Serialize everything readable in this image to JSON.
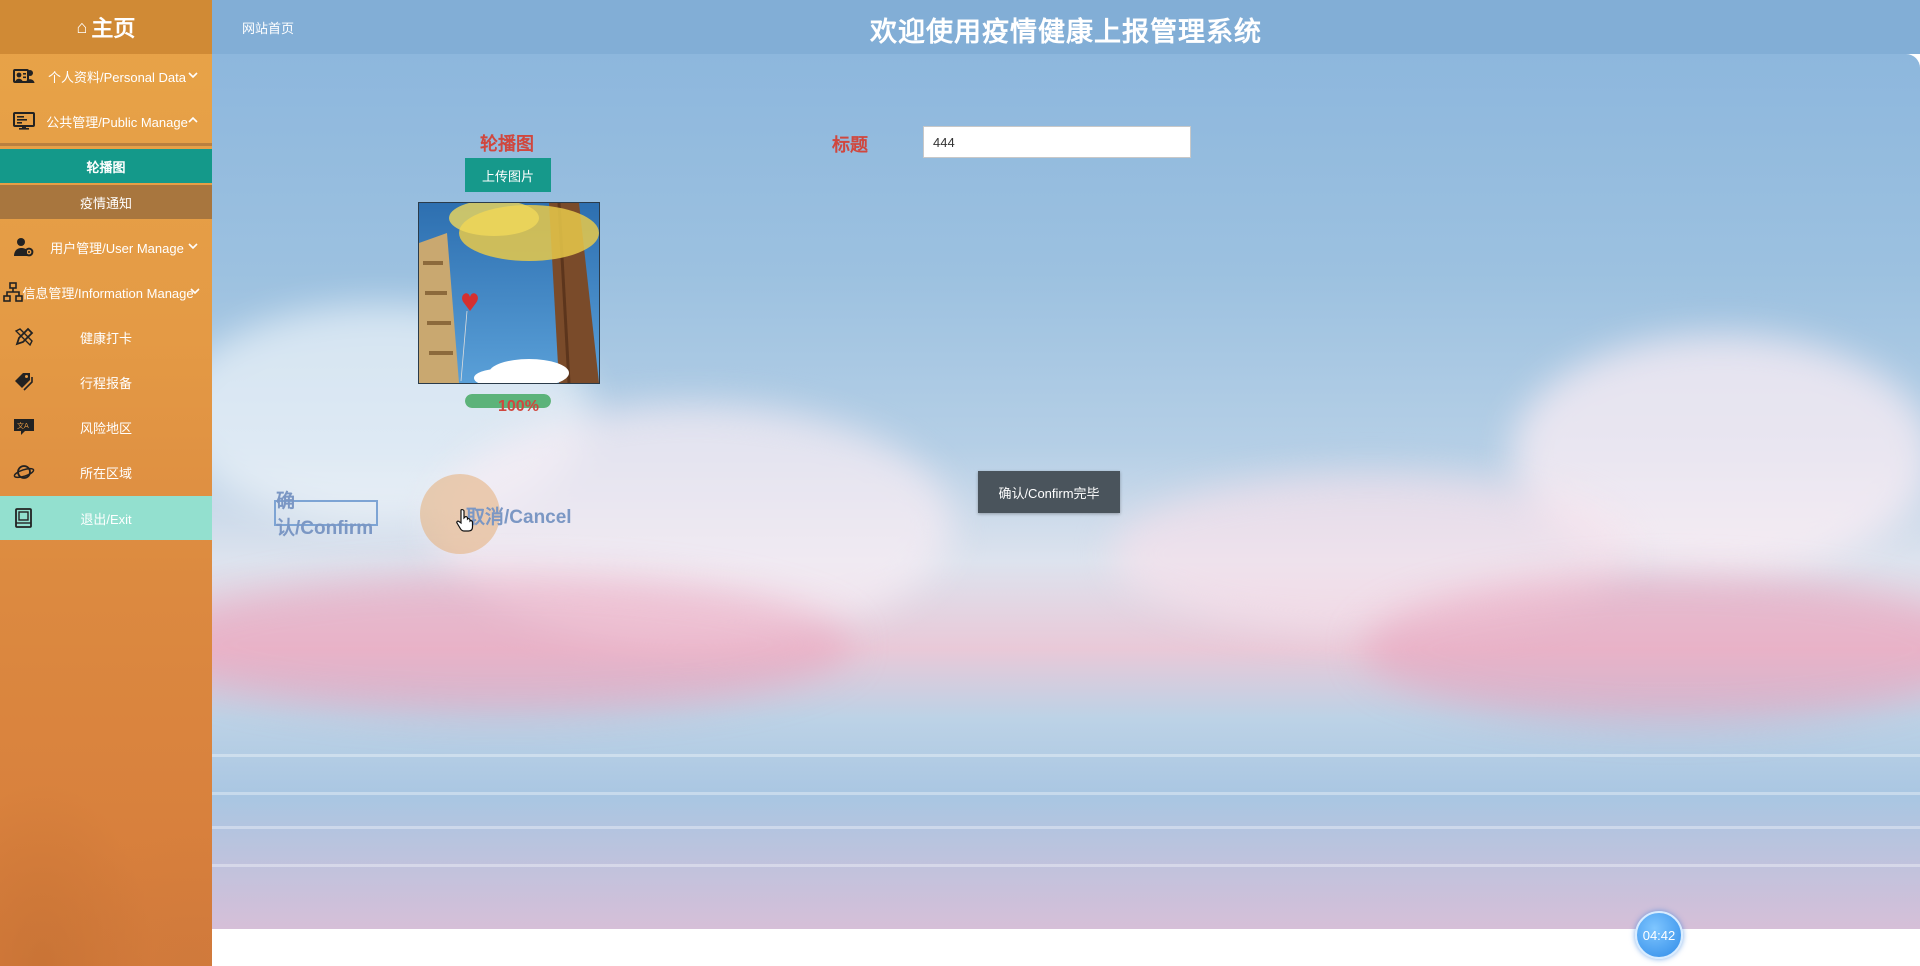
{
  "sidebar": {
    "home": "主页",
    "menu": [
      {
        "label": "个人资料/Personal Data",
        "icon": "user-card-icon",
        "chevron": "down"
      },
      {
        "label": "公共管理/Public Manage",
        "icon": "monitor-icon",
        "chevron": "up"
      }
    ],
    "submenu": [
      {
        "label": "轮播图",
        "active": true
      },
      {
        "label": "疫情通知",
        "active": false
      }
    ],
    "menu2": [
      {
        "label": "用户管理/User Manage",
        "icon": "user-gear-icon",
        "chevron": "down"
      },
      {
        "label": "信息管理/Information Manage",
        "icon": "sitemap-icon",
        "chevron": "down"
      },
      {
        "label": "健康打卡",
        "icon": "pencil-ruler-icon"
      },
      {
        "label": "行程报备",
        "icon": "tags-icon"
      },
      {
        "label": "风险地区",
        "icon": "translate-icon"
      },
      {
        "label": "所在区域",
        "icon": "planet-icon"
      },
      {
        "label": "退出/Exit",
        "icon": "book-icon"
      }
    ]
  },
  "header": {
    "home_link": "网站首页",
    "title": "欢迎使用疫情健康上报管理系统"
  },
  "form": {
    "carousel_label": "轮播图",
    "upload_button": "上传图片",
    "upload_progress": 1.0,
    "progress_text": "100%",
    "title_label": "标题",
    "title_value": "444",
    "confirm_done_button": "确认/Confirm完毕",
    "confirm_link": "确认/Confirm",
    "cancel_link": "取消/Cancel"
  },
  "timer": "04:42",
  "colors": {
    "sidebar_bg": "#e49a45",
    "active_submenu": "#14998a",
    "exit_highlight": "#93e0cf",
    "topbar": "#82aed6",
    "label_red": "#d0473e",
    "upload_button": "#16998b",
    "confirm_done": "#4a545c",
    "link_blue": "#7b97c4"
  }
}
